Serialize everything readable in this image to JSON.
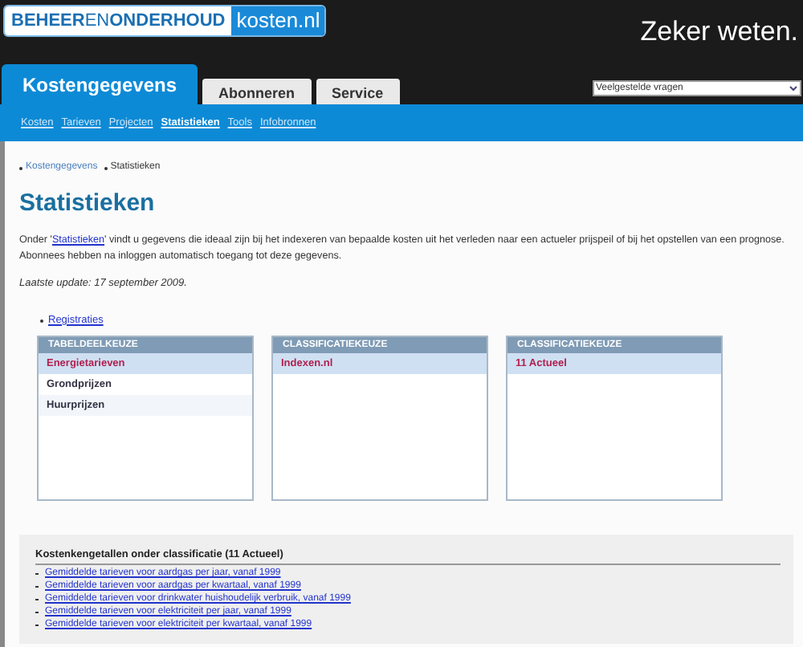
{
  "logo": {
    "part_1": "BEHEER",
    "part_2": "EN",
    "part_3": "ONDERHOUD",
    "part_4": "kosten.nl"
  },
  "tagline": "Zeker weten.",
  "tabs": [
    {
      "label": "Kostengegevens",
      "selected": true
    },
    {
      "label": "Abonneren",
      "selected": false
    },
    {
      "label": "Service",
      "selected": false
    }
  ],
  "quick_select": {
    "value": "Veelgestelde vragen"
  },
  "subnav": [
    {
      "label": "Kosten",
      "selected": false
    },
    {
      "label": "Tarieven",
      "selected": false
    },
    {
      "label": "Projecten",
      "selected": false
    },
    {
      "label": "Statistieken",
      "selected": true
    },
    {
      "label": "Tools",
      "selected": false
    },
    {
      "label": "Infobronnen",
      "selected": false
    }
  ],
  "breadcrumb": [
    {
      "label": "Kostengegevens",
      "kind": "link"
    },
    {
      "label": "Statistieken",
      "kind": "current"
    }
  ],
  "heading": "Statistieken",
  "intro": {
    "before": "Onder '",
    "link": "Statistieken",
    "after": "' vindt u gegevens die ideaal zijn bij het indexeren van bepaalde kosten uit het verleden naar een actueler prijspeil of bij het opstellen van een prognose. Abonnees hebben na inloggen automatisch toegang tot deze gegevens."
  },
  "last_update": "Laatste update: 17 september 2009.",
  "links": [
    "Registraties"
  ],
  "panels": [
    {
      "title": "TABELDEELKEUZE",
      "items": [
        {
          "label": "Energietarieven",
          "selected": true
        },
        {
          "label": "Grondprijzen",
          "selected": false
        },
        {
          "label": "Huurprijzen",
          "selected": false
        }
      ]
    },
    {
      "title": "CLASSIFICATIEKEUZE",
      "items": [
        {
          "label": "Indexen.nl",
          "selected": true
        }
      ]
    },
    {
      "title": "CLASSIFICATIEKEUZE",
      "items": [
        {
          "label": "11 Actueel",
          "selected": true
        }
      ]
    }
  ],
  "results": {
    "title": "Kostenkengetallen onder classificatie (11 Actueel)",
    "links": [
      "Gemiddelde tarieven voor aardgas per jaar, vanaf 1999",
      "Gemiddelde tarieven voor aardgas per kwartaal, vanaf 1999",
      "Gemiddelde tarieven voor drinkwater huishoudelijk verbruik, vanaf 1999",
      "Gemiddelde tarieven voor elektriciteit per jaar, vanaf 1999",
      "Gemiddelde tarieven voor elektriciteit per kwartaal, vanaf 1999"
    ]
  }
}
